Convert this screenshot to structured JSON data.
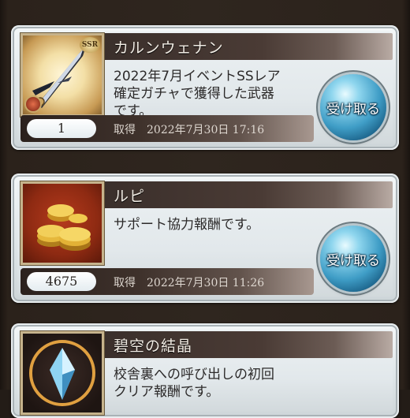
{
  "items": [
    {
      "title": "カルンウェナン",
      "description_lines": [
        "2022年7月イベントSSレア",
        "確定ガチャで獲得した武器",
        "です。"
      ],
      "quantity": "1",
      "acquired": "取得　2022年7月30日 17:16",
      "claim_label": "受け取る",
      "rarity_badge": "SSR",
      "icon": "dagger-weapon-icon"
    },
    {
      "title": "ルピ",
      "description_lines": [
        "サポート協力報酬です。",
        "",
        ""
      ],
      "quantity": "4675",
      "acquired": "取得　2022年7月30日 11:26",
      "claim_label": "受け取る",
      "icon": "gold-coins-icon"
    },
    {
      "title": "碧空の結晶",
      "description_lines": [
        "校舎裏への呼び出しの初回",
        "クリア報酬です。",
        ""
      ],
      "icon": "blue-crystal-icon"
    }
  ],
  "colors": {
    "orb": "#3f9dc6",
    "title_bar": "#4a3b35",
    "background": "#2f261f"
  }
}
